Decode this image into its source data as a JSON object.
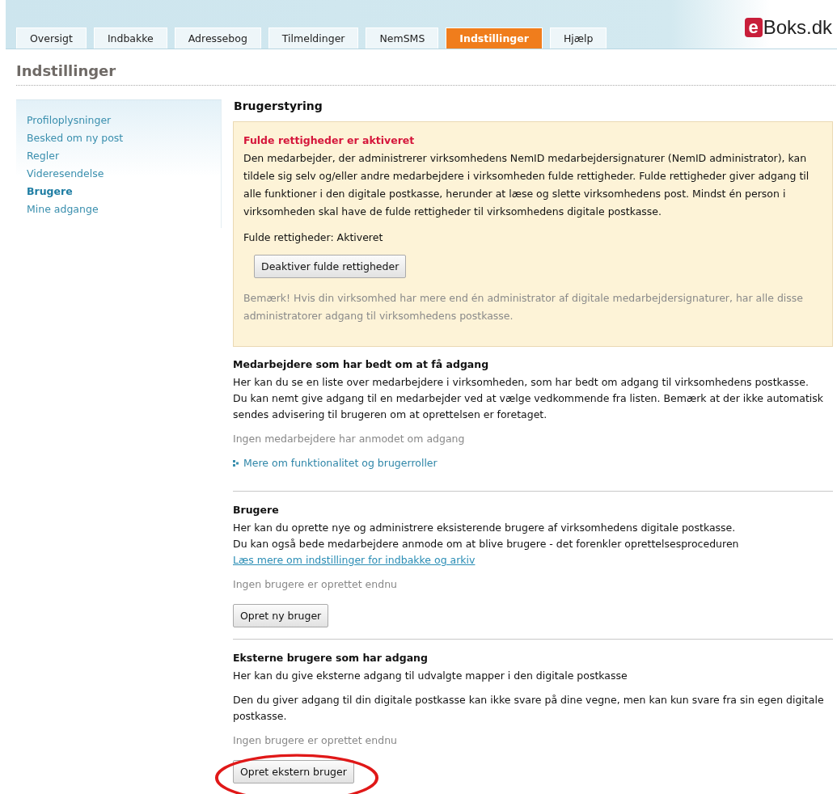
{
  "logo": {
    "mark": "e",
    "text": "Boks.dk"
  },
  "tabs": [
    {
      "label": "Oversigt",
      "selected": false
    },
    {
      "label": "Indbakke",
      "selected": false
    },
    {
      "label": "Adressebog",
      "selected": false
    },
    {
      "label": "Tilmeldinger",
      "selected": false
    },
    {
      "label": "NemSMS",
      "selected": false
    },
    {
      "label": "Indstillinger",
      "selected": true
    },
    {
      "label": "Hjælp",
      "selected": false
    }
  ],
  "page_title": "Indstillinger",
  "sidebar": {
    "items": [
      {
        "label": "Profiloplysninger",
        "selected": false
      },
      {
        "label": "Besked om ny post",
        "selected": false
      },
      {
        "label": "Regler",
        "selected": false
      },
      {
        "label": "Videresendelse",
        "selected": false
      },
      {
        "label": "Brugere",
        "selected": true
      },
      {
        "label": "Mine adgange",
        "selected": false
      }
    ]
  },
  "content_title": "Brugerstyring",
  "notice": {
    "heading": "Fulde rettigheder er aktiveret",
    "text": "Den medarbejder, der administrerer virksomhedens NemID medarbejdersignaturer (NemID administrator), kan tildele sig selv og/eller andre medarbejdere i virksomheden fulde rettigheder. Fulde rettigheder giver adgang til alle funktioner i den digitale postkasse, herunder at læse og slette virksomhedens post. Mindst én person i virksomheden skal have de fulde rettigheder til virksomhedens digitale postkasse.",
    "status": "Fulde rettigheder: Aktiveret",
    "button": "Deaktiver fulde rettigheder",
    "note": "Bemærk! Hvis din virksomhed har mere end én administrator af digitale medarbejdersignaturer, har alle disse administratorer adgang til virksomhedens postkasse."
  },
  "sections": [
    {
      "heading": "Medarbejdere som har bedt om at få adgang",
      "blocks": [
        {
          "kind": "text",
          "lines": [
            "Her kan du se en liste over medarbejdere i virksomheden, som har bedt om adgang til virksomhedens postkasse.",
            "Du kan nemt give adgang til en medarbejder ved at vælge vedkommende fra listen. Bemærk at der ikke automatisk sendes advisering til brugeren om at oprettelsen er foretaget."
          ]
        },
        {
          "kind": "empty",
          "text": "Ingen medarbejdere har anmodet om adgang"
        },
        {
          "kind": "more-link",
          "text": "Mere om funktionalitet og brugerroller"
        }
      ]
    },
    {
      "heading": "Brugere",
      "blocks": [
        {
          "kind": "text",
          "lines": [
            "Her kan du oprette nye og administrere eksisterende brugere af virksomhedens digitale postkasse.",
            "Du kan også bede medarbejdere anmode om at blive brugere - det forenkler oprettelsesproceduren"
          ],
          "link": "Læs mere om indstillinger for indbakke og arkiv"
        },
        {
          "kind": "empty",
          "text": "Ingen brugere er oprettet endnu"
        },
        {
          "kind": "button",
          "text": "Opret ny bruger",
          "circled": false
        }
      ]
    },
    {
      "heading": "Eksterne brugere som har adgang",
      "blocks": [
        {
          "kind": "text",
          "lines": [
            "Her kan du give eksterne adgang til udvalgte mapper i den digitale postkasse"
          ]
        },
        {
          "kind": "text",
          "lines": [
            "Den du giver adgang til din digitale postkasse kan ikke svare på dine vegne, men kan kun svare fra sin egen digitale postkasse."
          ]
        },
        {
          "kind": "empty",
          "text": "Ingen brugere er oprettet endnu"
        },
        {
          "kind": "button",
          "text": "Opret ekstern bruger",
          "circled": true
        }
      ]
    }
  ]
}
